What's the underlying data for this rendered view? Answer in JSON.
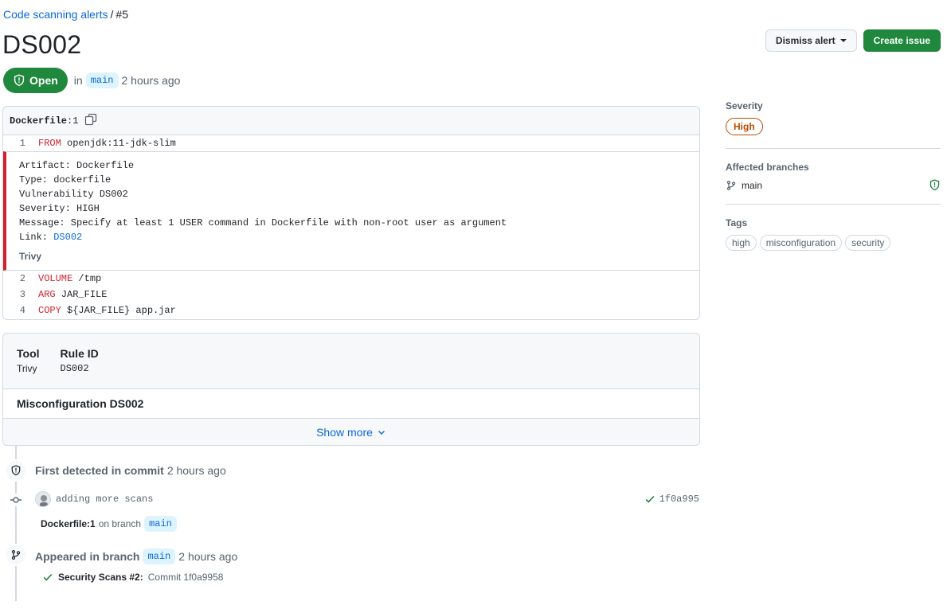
{
  "breadcrumb": {
    "parent": "Code scanning alerts",
    "separator": "/",
    "current": "#5"
  },
  "page_title": "DS002",
  "status": {
    "state": "Open",
    "in_word": "in",
    "branch": "main",
    "time": "2 hours ago"
  },
  "actions": {
    "dismiss_label": "Dismiss alert",
    "create_issue_label": "Create issue"
  },
  "code": {
    "file": "Dockerfile",
    "line_ref": ":1",
    "lines_top": [
      {
        "num": "1",
        "keyword": "FROM",
        "rest": " openjdk:11-jdk-slim"
      }
    ],
    "alert_lines": [
      "Artifact: Dockerfile",
      "Type: dockerfile",
      "Vulnerability DS002",
      "Severity: HIGH",
      "Message: Specify at least 1 USER command in Dockerfile with non-root user as argument"
    ],
    "link_prefix": "Link: ",
    "link_text": "DS002",
    "tool_label": "Trivy",
    "lines_bottom": [
      {
        "num": "2",
        "keyword": "VOLUME",
        "rest": " /tmp"
      },
      {
        "num": "3",
        "keyword": "ARG",
        "rest": " JAR_FILE"
      },
      {
        "num": "4",
        "keyword": "COPY",
        "rest": " ${JAR_FILE} app.jar"
      }
    ]
  },
  "details": {
    "tool_header": "Tool",
    "tool_value": "Trivy",
    "rule_header": "Rule ID",
    "rule_value": "DS002",
    "description_title": "Misconfiguration DS002",
    "show_more": "Show more"
  },
  "timeline": {
    "first_detected_bold": "First detected in commit",
    "first_detected_time": "2 hours ago",
    "commit_message": "adding more scans",
    "commit_sha": "1f0a995",
    "location_file": "Dockerfile:1",
    "location_on_branch": "on branch",
    "location_branch": "main",
    "appeared_bold": "Appeared in branch",
    "appeared_branch": "main",
    "appeared_time": "2 hours ago",
    "run_name": "Security Scans #2:",
    "run_commit": "Commit 1f0a9958"
  },
  "sidebar": {
    "severity_header": "Severity",
    "severity_value": "High",
    "branches_header": "Affected branches",
    "branch_name": "main",
    "tags_header": "Tags",
    "tags": [
      "high",
      "misconfiguration",
      "security"
    ]
  },
  "colors": {
    "open_green": "#1f883d",
    "severity_orange": "#bc4c00",
    "link_blue": "#0969da",
    "alert_red": "#cf222e"
  }
}
